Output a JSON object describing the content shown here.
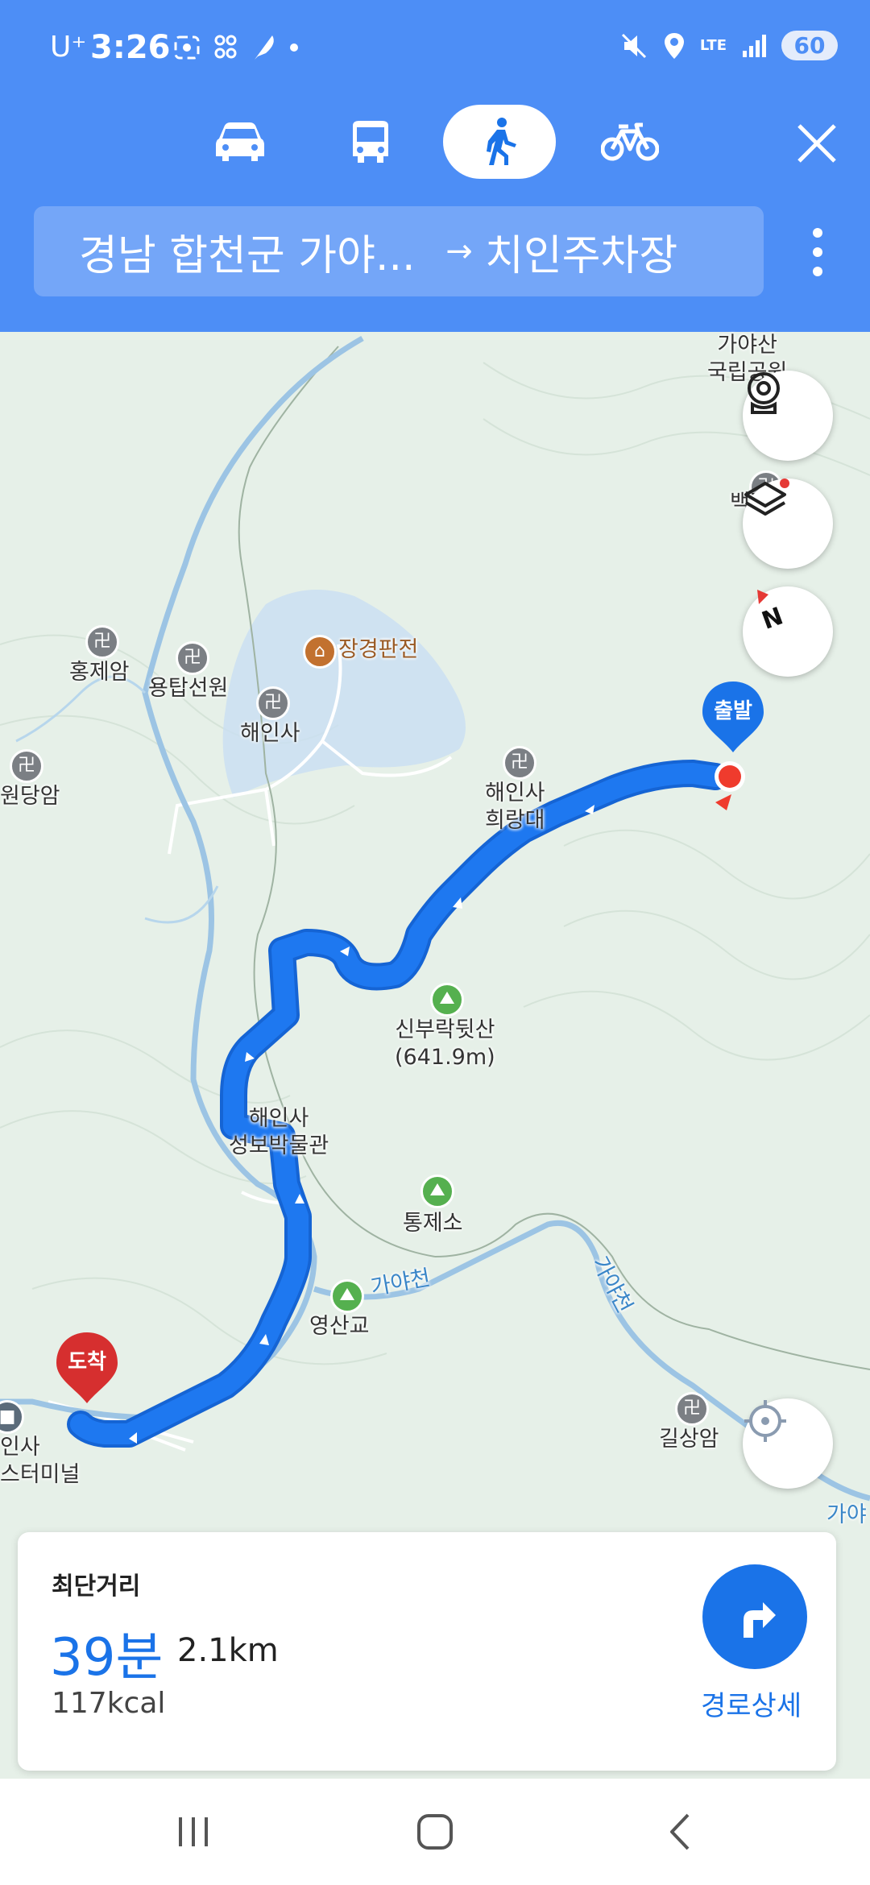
{
  "status_bar": {
    "carrier": "U⁺",
    "time": "3:26",
    "network": "LTE",
    "battery": "60"
  },
  "modes": {
    "car": "car-icon",
    "bus": "bus-icon",
    "walk": "walk-icon",
    "bike": "bike-icon",
    "active": "walk"
  },
  "route": {
    "origin": "경남 합천군 가야...",
    "arrow": "→",
    "destination": "치인주차장"
  },
  "map": {
    "labels": {
      "gayasan_park": "가야산\n국립공원",
      "hongjeam": "홍제암",
      "yongtapseonwon": "용탑선원",
      "janggyeongpanjeon": "장경판전",
      "haeinsa": "해인사",
      "wondangam": "원당암",
      "huirangdae": "해인사\n희랑대",
      "baeknyeonam": "백련암",
      "sinburak": "신부락뒷산\n(641.9m)",
      "museum": "해인사\n성보박물관",
      "tongjeso": "통제소",
      "yeongsangyo": "영산교",
      "gayacheon_1": "가야천",
      "gayacheon_2": "가야천",
      "gilsangam": "길상암",
      "terminal": "인사\n스터미널",
      "partial_right": "가야"
    },
    "start_pin": "출발",
    "end_pin": "도착"
  },
  "summary": {
    "title": "최단거리",
    "duration": "39분",
    "distance": "2.1km",
    "calories": "117kcal",
    "detail_label": "경로상세"
  },
  "colors": {
    "header": "#4d8ef6",
    "route": "#1a73e8",
    "start_pin": "#1a73e8",
    "end_pin": "#d62f2f"
  }
}
